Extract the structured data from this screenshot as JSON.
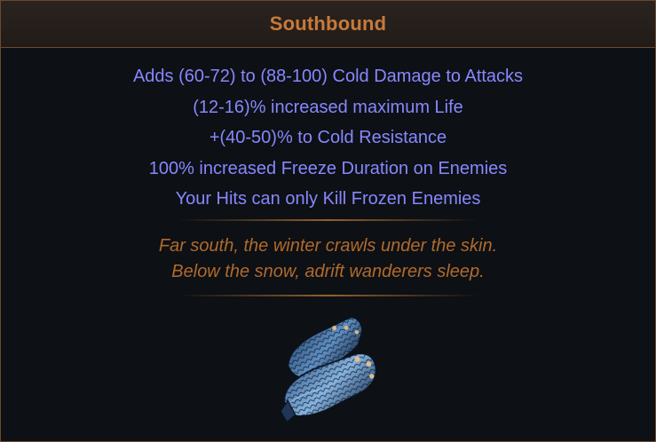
{
  "item": {
    "name": "Southbound",
    "explicit_mods": [
      "Adds (60-72) to (88-100) Cold Damage to Attacks",
      "(12-16)% increased maximum Life",
      "+(40-50)% to Cold Resistance",
      "100% increased Freeze Duration on Enemies",
      "Your Hits can only Kill Frozen Enemies"
    ],
    "flavour_text": [
      "Far south, the winter crawls under the skin.",
      "Below the snow, adrift wanderers sleep."
    ],
    "art_icon": "gloves-icon"
  },
  "colors": {
    "name": "#c87a3a",
    "mod": "#8787fe",
    "flavour": "#b06a2c",
    "border": "#6b4a2c"
  }
}
